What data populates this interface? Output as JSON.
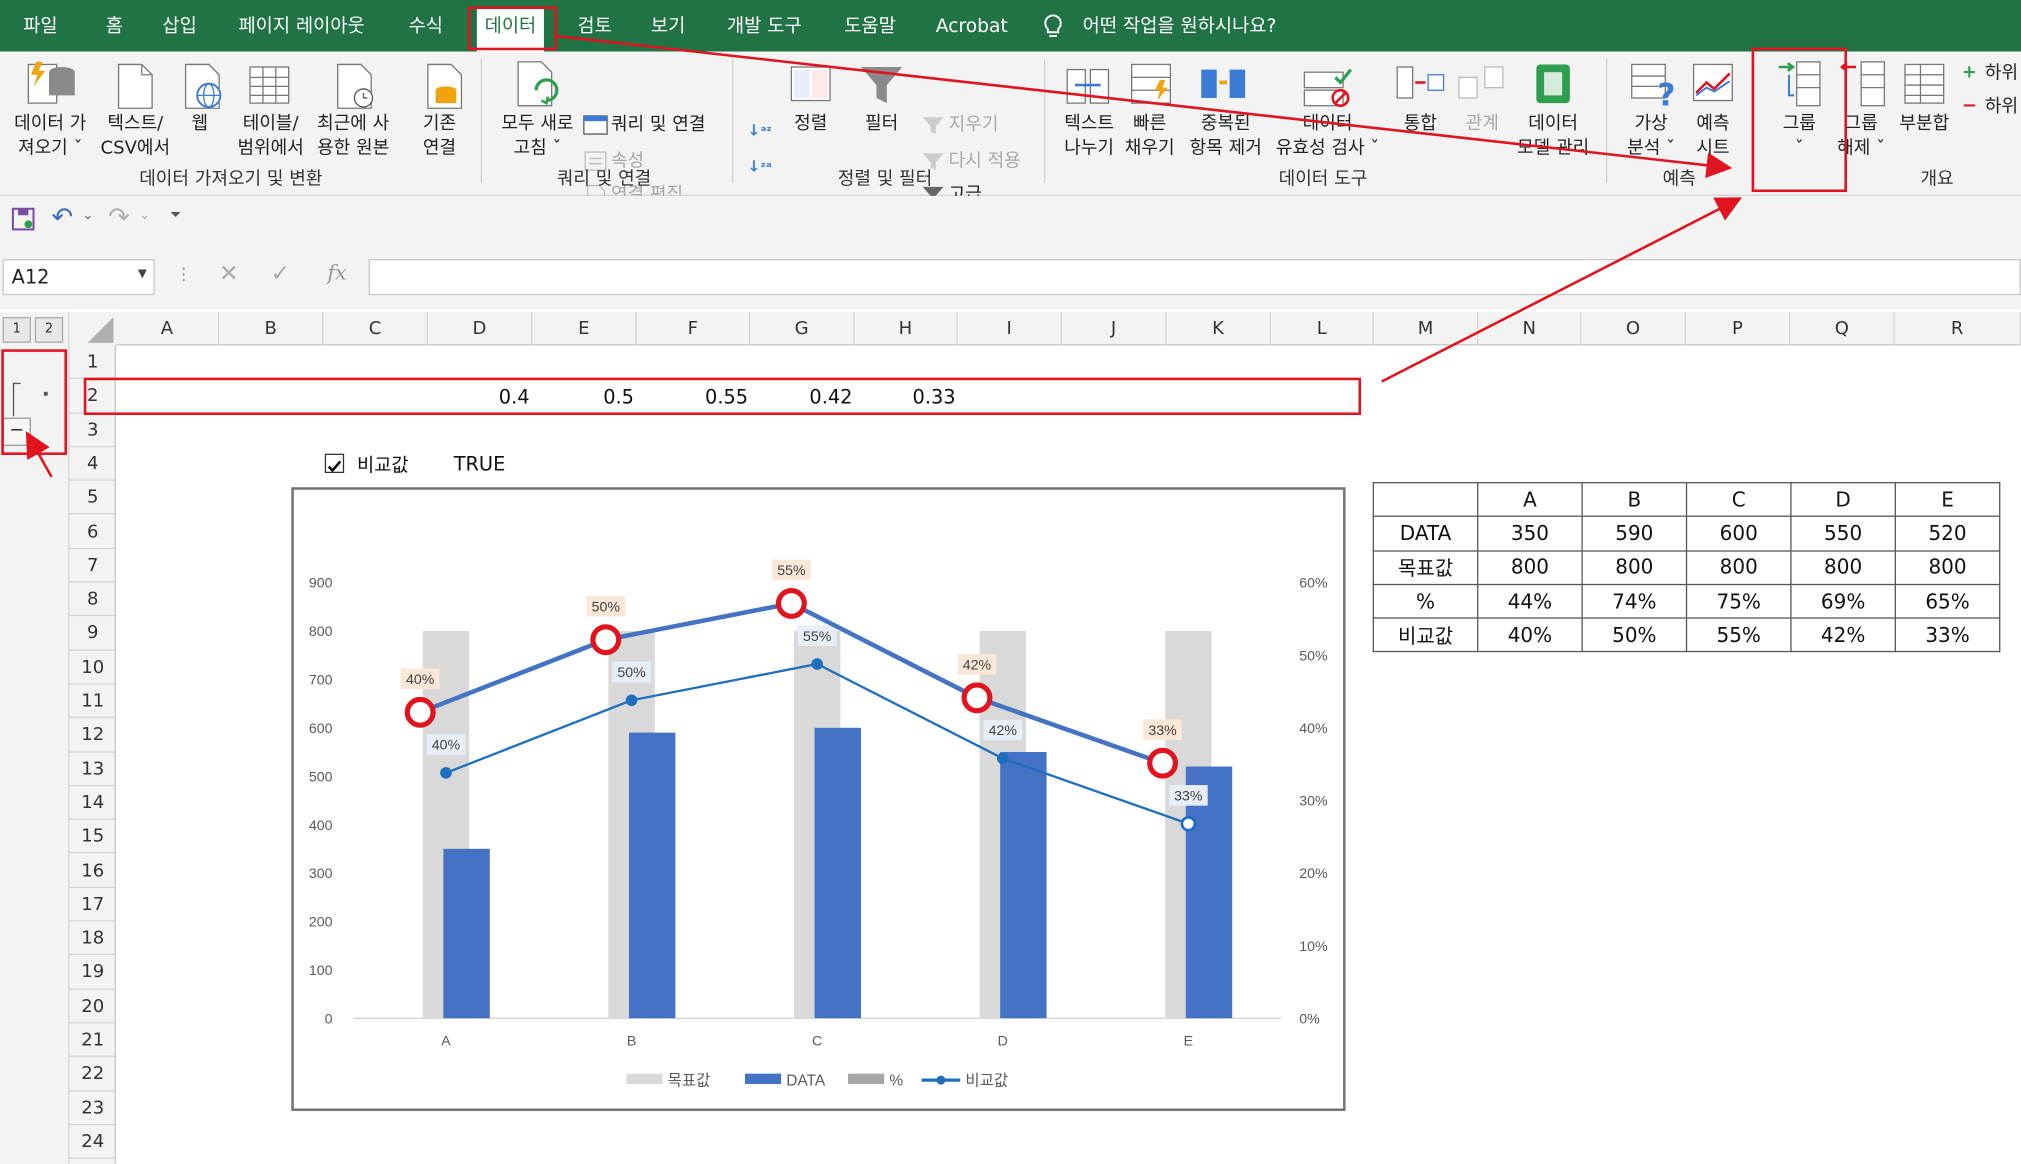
{
  "tabs": [
    "파일",
    "홈",
    "삽입",
    "페이지 레이아웃",
    "수식",
    "데이터",
    "검토",
    "보기",
    "개발 도구",
    "도움말",
    "Acrobat"
  ],
  "active_tab": "데이터",
  "tell_me": "어떤 작업을 원하시나요?",
  "ribbon": {
    "get_data": [
      "데이터 가",
      "져오기 ˇ"
    ],
    "text_csv": [
      "텍스트/",
      "CSV에서"
    ],
    "web": [
      "웹"
    ],
    "table_range": [
      "테이블/",
      "범위에서"
    ],
    "recent": [
      "최근에 사",
      "용한 원본"
    ],
    "existing": [
      "기존",
      "연결"
    ],
    "refresh": [
      "모두 새로",
      "고침 ˇ"
    ],
    "queries": "쿼리 및 연결",
    "properties": "속성",
    "edit_links": "연결 편집",
    "sort": "정렬",
    "filter": "필터",
    "clear": "지우기",
    "reapply": "다시 적용",
    "advanced": "고급",
    "text_to_cols": [
      "텍스트",
      "나누기"
    ],
    "flash_fill": [
      "빠른",
      "채우기"
    ],
    "remove_dup": [
      "중복된",
      "항목 제거"
    ],
    "validation": [
      "데이터",
      "유효성 검사 ˇ"
    ],
    "consolidate": "통합",
    "relations": "관계",
    "data_model": [
      "데이터",
      "모델 관리"
    ],
    "whatif": [
      "가상",
      "분석 ˇ"
    ],
    "forecast": [
      "예측",
      "시트"
    ],
    "group": [
      "그룹",
      "ˇ"
    ],
    "ungroup": [
      "그룹",
      "해제 ˇ"
    ],
    "subtotal": "부분합",
    "show_detail": "하위",
    "hide_detail": "하위",
    "groups": [
      "데이터 가져오기 및 변환",
      "쿼리 및 연결",
      "정렬 및 필터",
      "데이터 도구",
      "예측",
      "개요"
    ]
  },
  "namebox": "A12",
  "fx": "fx",
  "outline_levels": [
    "1",
    "2"
  ],
  "columns": [
    "A",
    "B",
    "C",
    "D",
    "E",
    "F",
    "G",
    "H",
    "I",
    "J",
    "K",
    "L",
    "M",
    "N",
    "O",
    "P",
    "Q",
    "R"
  ],
  "rows": [
    "1",
    "2",
    "3",
    "4",
    "5",
    "6",
    "7",
    "8",
    "9",
    "10",
    "11",
    "12",
    "13",
    "14",
    "15",
    "16",
    "17",
    "18",
    "19",
    "20",
    "21",
    "22",
    "23",
    "24"
  ],
  "row2_values": [
    "0.4",
    "0.5",
    "0.55",
    "0.42",
    "0.33"
  ],
  "checkbox_label": "비교값",
  "checkbox_value": "TRUE",
  "table": {
    "header": [
      "",
      "A",
      "B",
      "C",
      "D",
      "E"
    ],
    "rows": [
      [
        "DATA",
        "350",
        "590",
        "600",
        "550",
        "520"
      ],
      [
        "목표값",
        "800",
        "800",
        "800",
        "800",
        "800"
      ],
      [
        "%",
        "44%",
        "74%",
        "75%",
        "69%",
        "65%"
      ],
      [
        "비교값",
        "40%",
        "50%",
        "55%",
        "42%",
        "33%"
      ]
    ]
  },
  "chart_data": {
    "type": "bar",
    "categories": [
      "A",
      "B",
      "C",
      "D",
      "E"
    ],
    "y_left_ticks": [
      "0",
      "100",
      "200",
      "300",
      "400",
      "500",
      "600",
      "700",
      "800",
      "900"
    ],
    "y_right_ticks": [
      "0%",
      "10%",
      "20%",
      "30%",
      "40%",
      "50%",
      "60%"
    ],
    "ylim_left": [
      0,
      900
    ],
    "ylim_right": [
      0,
      0.6
    ],
    "series": [
      {
        "name": "목표값",
        "type": "bar",
        "values": [
          800,
          800,
          800,
          800,
          800
        ],
        "color": "#d9d9d9"
      },
      {
        "name": "DATA",
        "type": "bar",
        "values": [
          350,
          590,
          600,
          550,
          520
        ],
        "color": "#4472c4"
      },
      {
        "name": "%",
        "type": "line",
        "values": [
          0.4,
          0.5,
          0.55,
          0.42,
          0.33
        ],
        "labels": [
          "40%",
          "50%",
          "55%",
          "42%",
          "33%"
        ],
        "color": "#4472c4"
      },
      {
        "name": "비교값",
        "type": "line",
        "values": [
          0.4,
          0.5,
          0.55,
          0.42,
          0.33
        ],
        "labels": [
          "40%",
          "50%",
          "55%",
          "42%",
          "33%"
        ],
        "color": "#1f6fbf"
      }
    ],
    "legend": [
      "목표값",
      "DATA",
      "%",
      "비교값"
    ],
    "legend_position": "bottom"
  },
  "colors": {
    "excel_green": "#217346",
    "highlight_red": "#e1131e"
  }
}
